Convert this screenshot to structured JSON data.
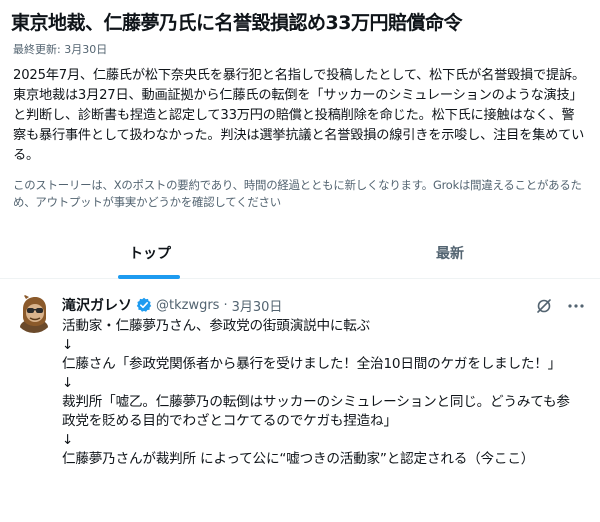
{
  "story": {
    "headline": "東京地裁、仁藤夢乃氏に名誉毀損認め33万円賠償命令",
    "last_updated": "最終更新: 3月30日",
    "summary": "2025年7月、仁藤氏が松下奈央氏を暴行犯と名指しで投稿したとして、松下氏が名誉毀損で提訴。東京地裁は3月27日、動画証拠から仁藤氏の転倒を「サッカーのシミュレーションのような演技」と判断し、診断書も捏造と認定して33万円の賠償と投稿削除を命じた。松下氏に接触はなく、警察も暴行事件として扱わなかった。判決は選挙抗議と名誉毀損の線引きを示唆し、注目を集めている。",
    "disclaimer": "このストーリーは、Xのポストの要約であり、時間の経過とともに新しくなります。Grokは間違えることがあるため、アウトプットが事実かどうかを確認してください"
  },
  "tabs": [
    {
      "label": "トップ",
      "active": true
    },
    {
      "label": "最新",
      "active": false
    }
  ],
  "post": {
    "display_name": "滝沢ガレソ",
    "handle": "@tkzwgrs",
    "separator": "·",
    "time": "3月30日",
    "lines": [
      "活動家・仁藤夢乃さん、参政党の街頭演説中に転ぶ",
      "↓",
      "仁藤さん「参政党関係者から暴行を受けました！全治10日間のケガをしました！」",
      "↓",
      "裁判所「嘘乙。仁藤夢乃の転倒はサッカーのシミュレーションと同じ。どうみても参政党を貶める目的でわざとコケてるのでケガも捏造ね」",
      "↓",
      "仁藤夢乃さんが裁判所 によって公に“嘘つきの活動家”と認定される（今ここ）"
    ]
  },
  "colors": {
    "accent": "#1d9bf0",
    "secondary_text": "#536471",
    "divider": "#eff3f4"
  },
  "icons": [
    "verified-badge-icon",
    "grok-icon",
    "more-options-icon"
  ]
}
